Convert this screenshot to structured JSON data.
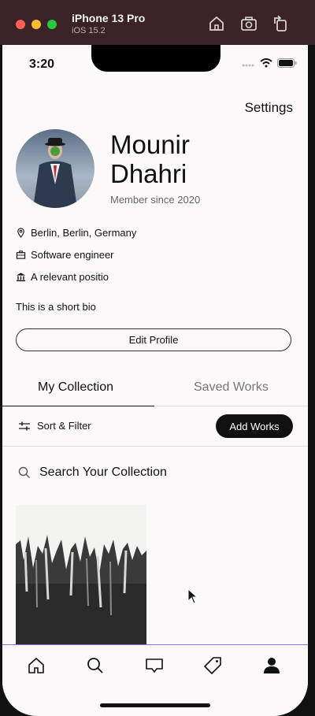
{
  "simulator": {
    "device_name": "iPhone 13 Pro",
    "os_version": "iOS 15.2"
  },
  "status_bar": {
    "time": "3:20"
  },
  "profile": {
    "settings_label": "Settings",
    "first_name": "Mounir",
    "last_name": "Dhahri",
    "member_since": "Member since 2020",
    "location": "Berlin, Berlin, Germany",
    "occupation": "Software engineer",
    "position": "A relevant positio",
    "bio": "This is a short bio",
    "edit_button": "Edit Profile"
  },
  "tabs": [
    {
      "label": "My Collection",
      "active": true
    },
    {
      "label": "Saved Works",
      "active": false
    }
  ],
  "toolbar": {
    "sort_filter_label": "Sort & Filter",
    "add_works_label": "Add Works"
  },
  "search": {
    "placeholder": "Search Your Collection"
  },
  "bottom_nav": [
    "home-icon",
    "search-icon",
    "inbox-icon",
    "tag-icon",
    "profile-icon"
  ],
  "colors": {
    "accent_line": "#8a72e6",
    "primary": "#111111"
  }
}
